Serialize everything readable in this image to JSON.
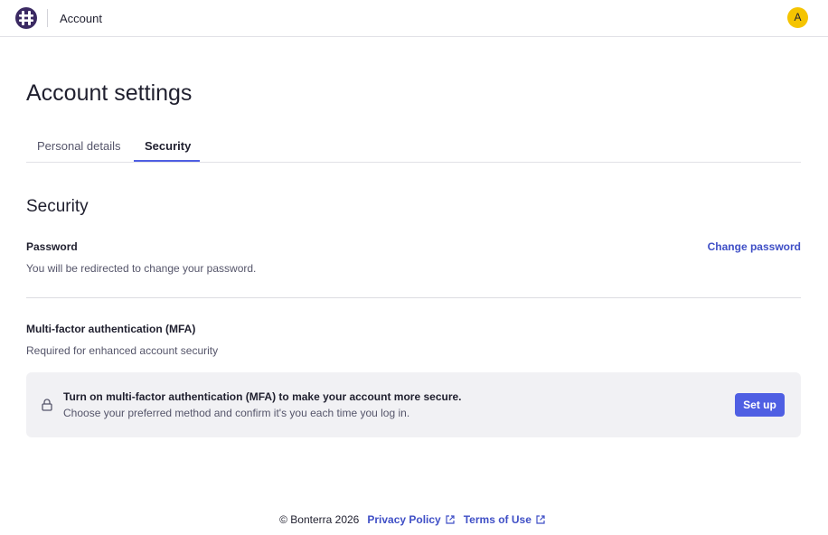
{
  "header": {
    "app_title": "Account",
    "avatar_initial": "A",
    "logo_icon": "bonterra-logo-icon",
    "colors": {
      "logo": "#3b2a63",
      "avatar": "#f5c400"
    }
  },
  "page": {
    "title": "Account settings",
    "tabs": [
      {
        "label": "Personal details",
        "active": false
      },
      {
        "label": "Security",
        "active": true
      }
    ]
  },
  "security": {
    "section_title": "Security",
    "password": {
      "label": "Password",
      "description": "You will be redirected to change your password.",
      "action_label": "Change password"
    },
    "mfa": {
      "label": "Multi-factor authentication (MFA)",
      "description": "Required for enhanced account security",
      "banner": {
        "icon": "lock-icon",
        "title": "Turn on multi-factor authentication (MFA) to make your account more secure.",
        "text": "Choose your preferred method and confirm it's you each time you log in.",
        "button_label": "Set up"
      }
    }
  },
  "footer": {
    "copyright": "© Bonterra 2026",
    "links": [
      {
        "label": "Privacy Policy",
        "icon": "external-link-icon"
      },
      {
        "label": "Terms of Use",
        "icon": "external-link-icon"
      }
    ]
  },
  "theme": {
    "accent": "#4f5fe3",
    "link": "#3f4fc6",
    "banner_bg": "#f1f1f4"
  }
}
